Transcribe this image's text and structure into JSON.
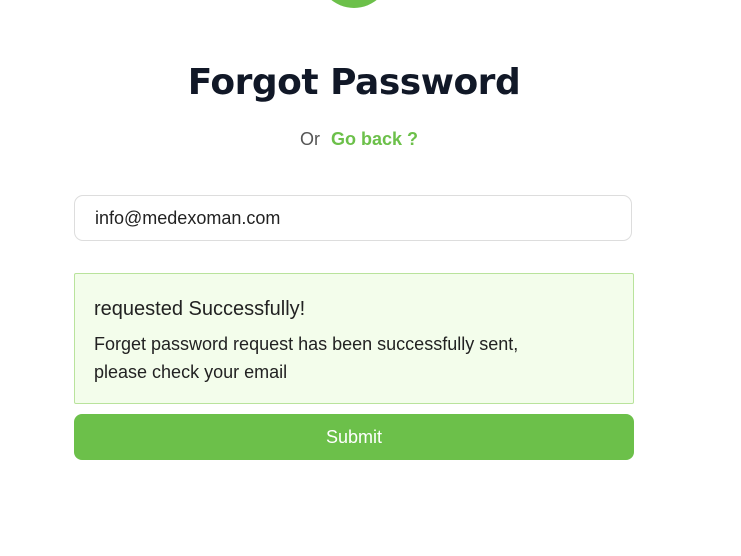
{
  "header": {
    "title": "Forgot Password",
    "or_text": "Or",
    "go_back_label": "Go back ?"
  },
  "form": {
    "email_value": "info@medexoman.com"
  },
  "alert": {
    "title": "requested Successfully!",
    "message": "Forget password request has been successfully sent, please check your email"
  },
  "actions": {
    "submit_label": "Submit"
  },
  "colors": {
    "accent": "#6cc04a",
    "title": "#111827",
    "alert_bg": "#f3fdeb",
    "alert_border": "#b9e39c"
  }
}
